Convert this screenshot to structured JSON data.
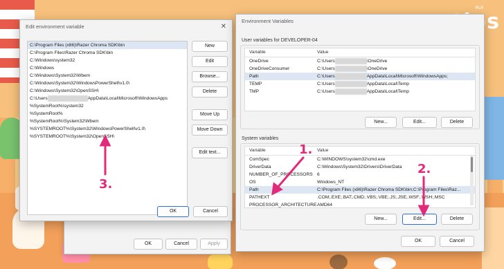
{
  "watermark": {
    "brand": "tips",
    "thai": "ทิปส์"
  },
  "behind_dialog": {
    "ok": "OK",
    "cancel": "Cancel",
    "apply": "Apply"
  },
  "edit_dialog": {
    "title": "Edit environment variable",
    "paths": [
      "C:\\Program Files (x86)\\Razer Chroma SDK\\bin",
      "C:\\Program Files\\Razer Chroma SDK\\bin",
      "C:\\Windows\\system32",
      "C:\\Windows",
      "C:\\Windows\\System32\\Wbem",
      "C:\\Windows\\System32\\WindowsPowerShell\\v1.0\\",
      "C:\\Windows\\System32\\OpenSSH\\",
      "C:\\Users",
      "%SystemRoot%\\system32",
      "%SystemRoot%",
      "%SystemRoot%\\System32\\Wbem",
      "%SYSTEMROOT%\\System32\\WindowsPowerShell\\v1.0\\",
      "%SYSTEMROOT%\\System32\\OpenSSH\\"
    ],
    "user_path_suffix": "AppData\\Local\\Microsoft\\WindowsApps",
    "buttons": {
      "new": "New",
      "edit": "Edit",
      "browse": "Browse...",
      "delete": "Delete",
      "move_up": "Move Up",
      "move_down": "Move Down",
      "edit_text": "Edit text...",
      "ok": "OK",
      "cancel": "Cancel"
    }
  },
  "env_dialog": {
    "title": "Environment Variables",
    "user_section": "User variables for DEVELOPER-04",
    "system_section": "System variables",
    "col_variable": "Variable",
    "col_value": "Value",
    "user_vars": [
      {
        "name": "OneDrive",
        "prefix": "C:\\Users",
        "suffix": "\\OneDrive"
      },
      {
        "name": "OneDriveConsumer",
        "prefix": "C:\\Users",
        "suffix": "\\OneDrive"
      },
      {
        "name": "Path",
        "prefix": "C:\\Users",
        "suffix": "AppData\\Local\\Microsoft\\WindowsApps;"
      },
      {
        "name": "TEMP",
        "prefix": "C:\\Users",
        "suffix": "AppData\\Local\\Temp"
      },
      {
        "name": "TMP",
        "prefix": "C:\\Users",
        "suffix": "AppData\\Local\\Temp"
      }
    ],
    "system_vars": [
      {
        "name": "ComSpec",
        "value": "C:\\WINDOWS\\system32\\cmd.exe"
      },
      {
        "name": "DriverData",
        "value": "C:\\Windows\\System32\\Drivers\\DriverData"
      },
      {
        "name": "NUMBER_OF_PROCESSORS",
        "value": "6"
      },
      {
        "name": "OS",
        "value": "Windows_NT"
      },
      {
        "name": "Path",
        "value": "C:\\Program Files (x86)\\Razer Chroma SDK\\bin;C:\\Program Files\\Raz..."
      },
      {
        "name": "PATHEXT",
        "value": ".COM;.EXE;.BAT;.CMD;.VBS;.VBE;.JS;.JSE;.WSF;.WSH;.MSC"
      },
      {
        "name": "PROCESSOR_ARCHITECTURE",
        "value": "AMD64"
      }
    ],
    "buttons": {
      "new": "New...",
      "edit": "Edit...",
      "delete": "Delete",
      "ok": "OK",
      "cancel": "Cancel"
    }
  },
  "annotations": {
    "step1": "1.",
    "step2": "2.",
    "step3": "3."
  },
  "colors": {
    "annotation": "#e22a7a",
    "selection": "#dde7f3",
    "primary_border": "#2f6fd0"
  }
}
